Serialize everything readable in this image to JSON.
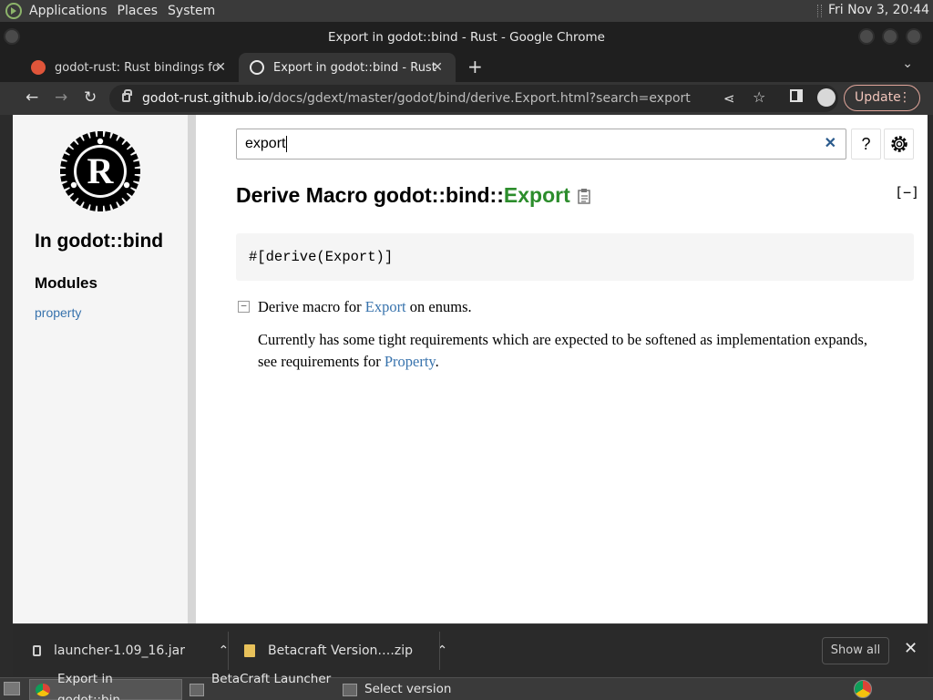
{
  "system_panel": {
    "menus": [
      "Applications",
      "Places",
      "System"
    ],
    "clock": "Fri Nov 3, 20:44"
  },
  "window": {
    "title": "Export in godot::bind - Rust - Google Chrome"
  },
  "tabs": [
    {
      "label": "godot-rust: Rust bindings for t",
      "icon": "godot-rust-favicon",
      "active": false
    },
    {
      "label": "Export in godot::bind - Rust",
      "icon": "rust-favicon",
      "active": true
    }
  ],
  "toolbar": {
    "url_host": "godot-rust.github.io",
    "url_path": "/docs/gdext/master/godot/bind/derive.Export.html?search=export",
    "update_label": "Update"
  },
  "sidebar": {
    "crate_title": "In godot::bind",
    "modules_heading": "Modules",
    "modules": [
      "property"
    ]
  },
  "search": {
    "value": "export",
    "help_label": "?"
  },
  "doc": {
    "heading_prefix": "Derive Macro godot::bind::",
    "heading_item": "Export",
    "collapse_label": "[−]",
    "code": "#[derive(Export)]",
    "toggle_label": "−",
    "summary_before": "Derive macro for ",
    "summary_link": "Export",
    "summary_after": " on enums.",
    "detail_before": "Currently has some tight requirements which are expected to be softened as implementation expands, see requirements for ",
    "detail_link": "Property",
    "detail_after": "."
  },
  "downloads": {
    "items": [
      {
        "name": "launcher-1.09_16.jar",
        "icon": "jar-file-icon"
      },
      {
        "name": "Betacraft Version….zip",
        "icon": "zip-file-icon"
      }
    ],
    "show_all_label": "Show all"
  },
  "taskbar": {
    "tasks": [
      {
        "label": "Export in godot::bin…",
        "icon": "chrome-icon",
        "active": true
      },
      {
        "label": "BetaCraft Launcher …",
        "icon": "java-app-icon",
        "active": false
      },
      {
        "label": "Select version",
        "icon": "java-app-icon",
        "active": false
      }
    ]
  },
  "colors": {
    "link": "#3873ad",
    "item_green": "#2c8d2c",
    "update_accent": "#f0c4ba"
  }
}
